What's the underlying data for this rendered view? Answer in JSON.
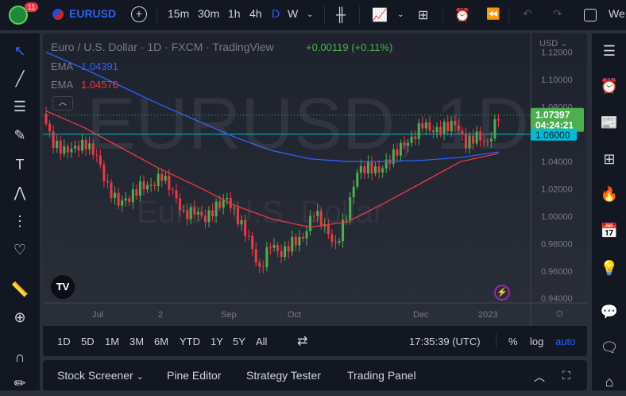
{
  "topbar": {
    "badge": "11",
    "symbol": "EURUSD",
    "intervals": [
      "15m",
      "30m",
      "1h",
      "4h",
      "D",
      "W"
    ],
    "active_interval": "D",
    "cutoff_text": "We"
  },
  "legend": {
    "title": "Euro / U.S. Dollar · 1D · FXCM · TradingView",
    "change": "+0.00119 (+0.11%)",
    "ema1_label": "EMA",
    "ema1_value": "1.04391",
    "ema2_label": "EMA",
    "ema2_value": "1.04576"
  },
  "watermark": {
    "symbol": "EURUSD, 1D",
    "name": "Euro / U.S. Dollar"
  },
  "price_axis": {
    "currency": "USD",
    "ticks": [
      "1.12000",
      "1.10000",
      "1.08000",
      "1.06000",
      "1.04000",
      "1.02000",
      "1.00000",
      "0.98000",
      "0.96000",
      "0.94000"
    ],
    "last_price": "1.07397",
    "countdown": "04:24:21",
    "line_price": "1.06000"
  },
  "time_axis": {
    "labels": [
      "Jul",
      "2",
      "Sep",
      "Oct",
      "Dec",
      "2023"
    ]
  },
  "timeframes": [
    "1D",
    "5D",
    "1M",
    "3M",
    "6M",
    "YTD",
    "1Y",
    "5Y",
    "All"
  ],
  "clock": "17:35:39 (UTC)",
  "scale": {
    "percent": "%",
    "log": "log",
    "auto": "auto"
  },
  "bottom_tabs": [
    "Stock Screener",
    "Pine Editor",
    "Strategy Tester",
    "Trading Panel"
  ],
  "colors": {
    "up": "#4caf50",
    "down": "#f23645",
    "ema_blue": "#2962ff",
    "ema_red": "#f23645",
    "hline": "#00bcd4",
    "accent": "#2962ff"
  },
  "chart_data": {
    "type": "candlestick",
    "ylim": [
      0.94,
      1.12
    ],
    "hline": 1.06,
    "closes": [
      1.075,
      1.053,
      1.048,
      1.05,
      1.053,
      1.044,
      1.021,
      1.01,
      1.013,
      1.022,
      1.022,
      1.03,
      1.018,
      1.001,
      1.004,
      0.998,
      1.007,
      1.013,
      0.998,
      0.984,
      0.96,
      0.98,
      0.972,
      0.981,
      0.984,
      1.004,
      0.992,
      0.978,
      1.001,
      1.033,
      1.036,
      1.033,
      1.042,
      1.051,
      1.056,
      1.068,
      1.062,
      1.065,
      1.068,
      1.053,
      1.059,
      1.053,
      1.074
    ],
    "ema_slow": [
      1.12,
      1.108,
      1.095,
      1.082,
      1.07,
      1.058,
      1.048,
      1.042,
      1.04,
      1.04,
      1.041,
      1.043,
      1.047
    ],
    "ema_fast": [
      1.077,
      1.065,
      1.05,
      1.035,
      1.022,
      1.008,
      0.998,
      0.992,
      0.996,
      1.01,
      1.025,
      1.04,
      1.046
    ]
  }
}
